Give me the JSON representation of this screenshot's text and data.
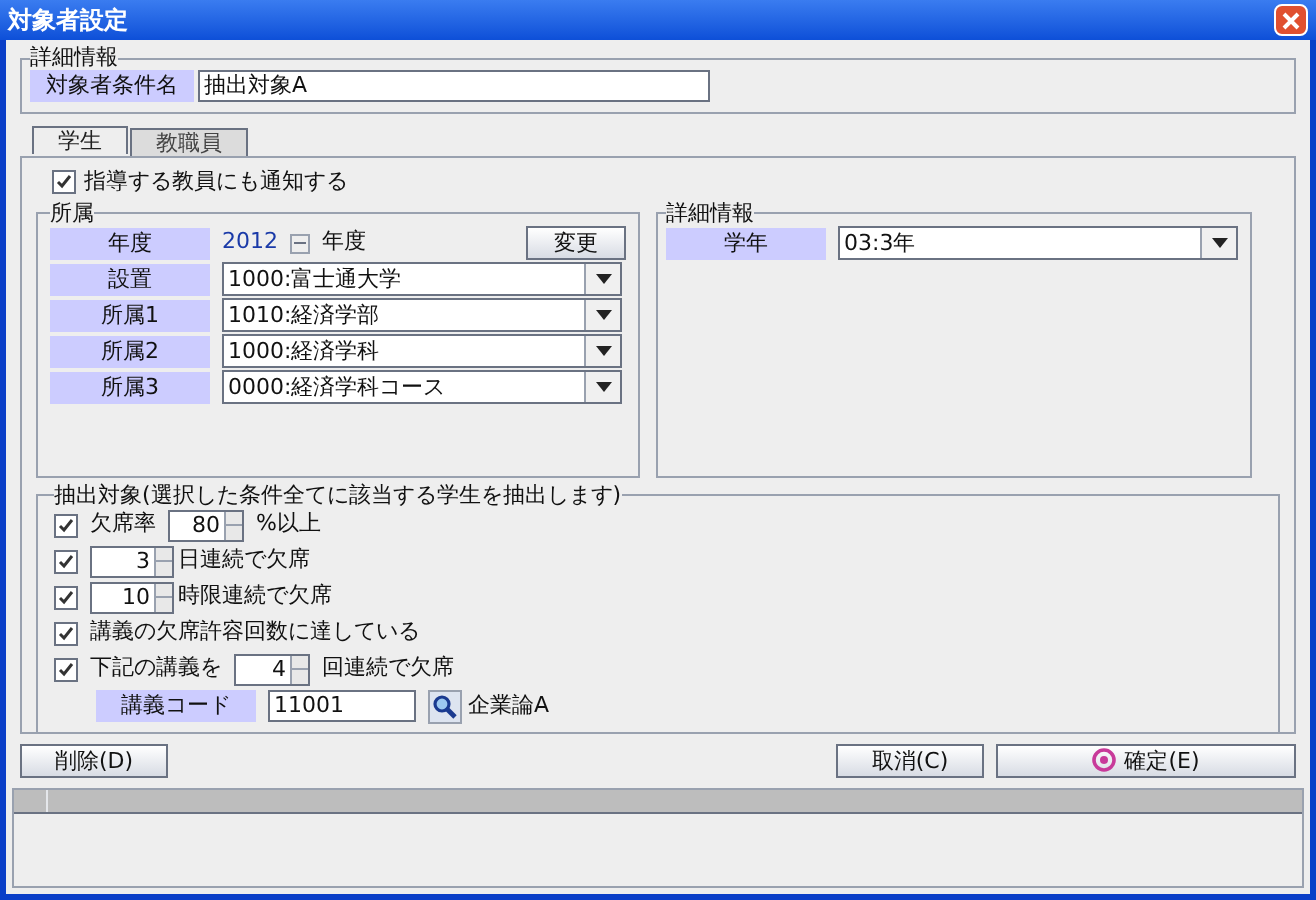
{
  "window": {
    "title": "対象者設定"
  },
  "details": {
    "legend": "詳細情報",
    "label": "対象者条件名",
    "value": "抽出対象A"
  },
  "tabs": [
    {
      "label": "学生",
      "selected": true
    },
    {
      "label": "教職員",
      "selected": false
    }
  ],
  "notify": {
    "label": "指導する教員にも通知する",
    "checked": true
  },
  "affiliation": {
    "legend": "所属",
    "year": {
      "label": "年度",
      "value": "2012",
      "unit": "年度",
      "button": "変更"
    },
    "rows": [
      {
        "label": "設置",
        "value": "1000:富士通大学"
      },
      {
        "label": "所属1",
        "value": "1010:経済学部"
      },
      {
        "label": "所属2",
        "value": "1000:経済学科"
      },
      {
        "label": "所属3",
        "value": "0000:経済学科コース"
      }
    ]
  },
  "detail_info": {
    "legend": "詳細情報",
    "rows": [
      {
        "label": "学年",
        "value": "03:3年"
      }
    ]
  },
  "criteria": {
    "legend": "抽出対象(選択した条件全てに該当する学生を抽出します)",
    "items": [
      {
        "kind": "prefix_spin",
        "checked": true,
        "label": "欠席率",
        "value": "80",
        "suffix": "%以上"
      },
      {
        "kind": "spin",
        "checked": true,
        "value": "3",
        "suffix": "日連続で欠席"
      },
      {
        "kind": "spin",
        "checked": true,
        "value": "10",
        "suffix": "時限連続で欠席"
      },
      {
        "kind": "text",
        "checked": true,
        "label": "講義の欠席許容回数に達している"
      },
      {
        "kind": "prefix_spin",
        "checked": true,
        "label": "下記の講義を",
        "value": "4",
        "suffix": "回連続で欠席"
      }
    ],
    "course": {
      "label": "講義コード",
      "value": "11001",
      "name": "企業論A"
    }
  },
  "buttons": {
    "delete": "削除(D)",
    "cancel": "取消(C)",
    "confirm": "確定(E)"
  }
}
